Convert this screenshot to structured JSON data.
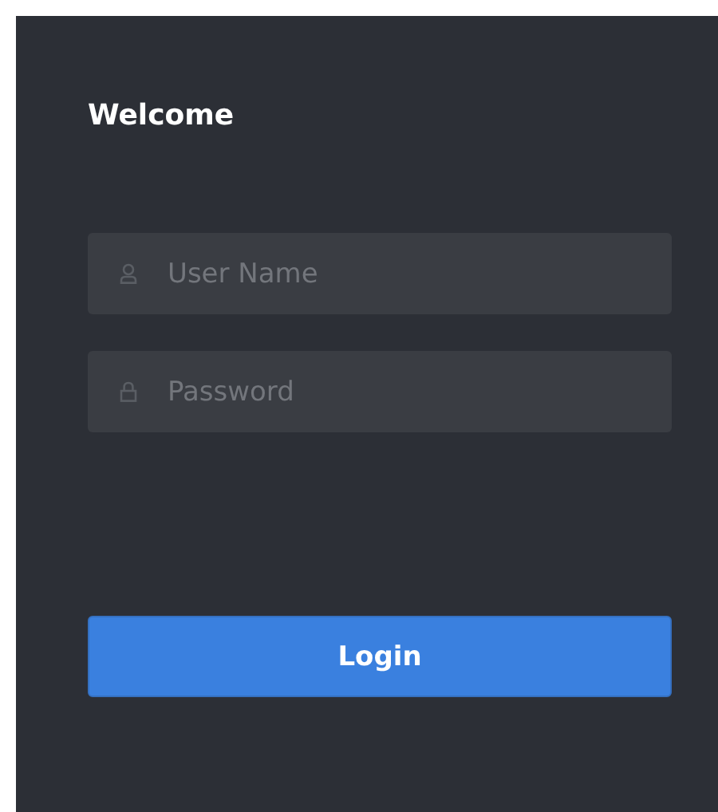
{
  "title": "Welcome",
  "fields": [
    {
      "kind": "user",
      "placeholder": "User Name"
    },
    {
      "kind": "password",
      "placeholder": "Password"
    }
  ],
  "button": "Login"
}
